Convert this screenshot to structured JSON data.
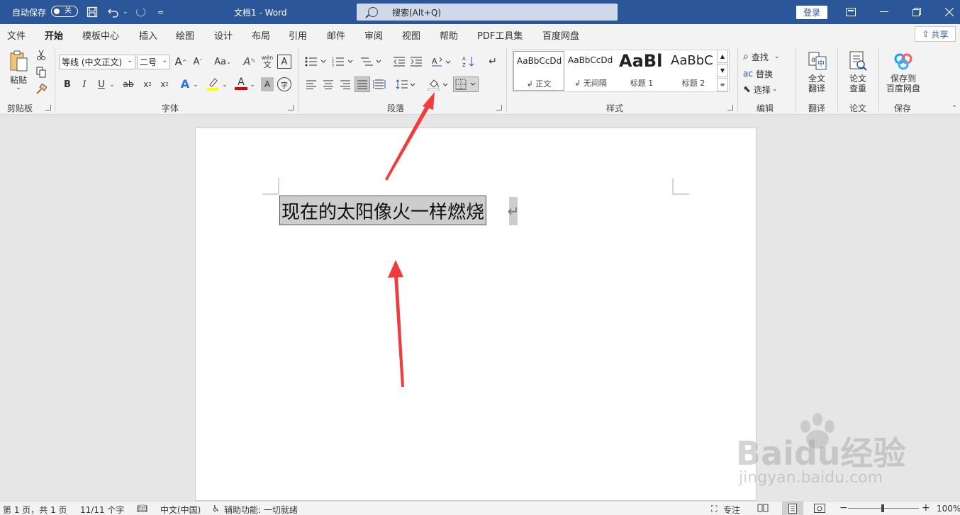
{
  "titlebar": {
    "autosave_label": "自动保存",
    "autosave_state": "关",
    "doc_title": "文档1  -  Word",
    "search_placeholder": "搜索(Alt+Q)",
    "login": "登录"
  },
  "menu": {
    "tabs": [
      "文件",
      "开始",
      "模板中心",
      "插入",
      "绘图",
      "设计",
      "布局",
      "引用",
      "邮件",
      "审阅",
      "视图",
      "帮助",
      "PDF工具集",
      "百度网盘"
    ],
    "share": "共享"
  },
  "ribbon": {
    "clipboard": {
      "paste": "粘贴",
      "label": "剪贴板"
    },
    "font": {
      "font_name": "等线 (中文正文)",
      "font_size": "二号",
      "grow": "A",
      "shrink": "A",
      "change_case": "Aa",
      "phonetic_top": "wén",
      "phonetic_bottom": "文",
      "border_char": "A",
      "bold": "B",
      "italic": "I",
      "underline": "U",
      "strike": "ab",
      "subscript": "x",
      "superscript": "x",
      "effects": "A",
      "font_color": "A",
      "shading": "A",
      "enclose": "字",
      "label": "字体"
    },
    "paragraph": {
      "label": "段落"
    },
    "styles": {
      "items": [
        {
          "preview": "AaBbCcDd",
          "name": "正文"
        },
        {
          "preview": "AaBbCcDd",
          "name": "无间隔"
        },
        {
          "preview": "AaBl",
          "name": "标题 1"
        },
        {
          "preview": "AaBbC",
          "name": "标题 2"
        }
      ],
      "label": "样式"
    },
    "editing": {
      "find": "查找",
      "replace": "替换",
      "select": "选择",
      "label": "编辑"
    },
    "translate": {
      "button_l1": "全文",
      "button_l2": "翻译",
      "label": "翻译"
    },
    "paper": {
      "button_l1": "论文",
      "button_l2": "查重",
      "label": "论文"
    },
    "save": {
      "button_l1": "保存到",
      "button_l2": "百度网盘",
      "label": "保存"
    }
  },
  "document": {
    "text": "现在的太阳像火一样燃烧",
    "para_mark": "↵"
  },
  "statusbar": {
    "page": "第 1 页，共 1 页",
    "words": "11/11 个字",
    "language": "中文(中国)",
    "accessibility": "辅助功能: 一切就绪",
    "focus": "专注",
    "zoom": "100%"
  },
  "watermark": {
    "brand": "Baidu经验",
    "url": "jingyan.baidu.com"
  },
  "colors": {
    "titlebar": "#2b579a",
    "highlight": "#ffff00",
    "font_color": "#e00000",
    "arrow": "#f03c3c"
  }
}
